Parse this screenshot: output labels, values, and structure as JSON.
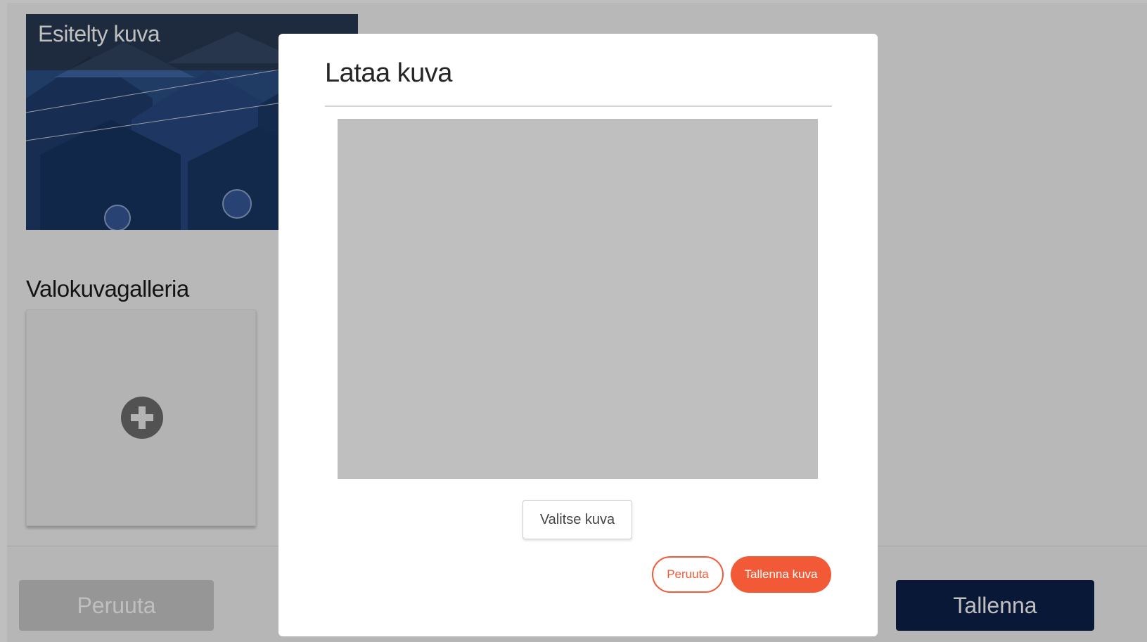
{
  "background": {
    "featured_image": {
      "title": "Esitelty kuva"
    },
    "gallery": {
      "title": "Valokuvagalleria",
      "add_icon": "plus-circle-icon"
    },
    "footer": {
      "cancel_label": "Peruuta",
      "save_label": "Tallenna"
    }
  },
  "modal": {
    "title": "Lataa kuva",
    "choose_label": "Valitse kuva",
    "cancel_label": "Peruuta",
    "save_label": "Tallenna kuva"
  },
  "colors": {
    "accent": "#f25a37",
    "primary_dark": "#0c2049",
    "disabled": "#c8c8c8",
    "preview_placeholder": "#bfbfbf"
  }
}
